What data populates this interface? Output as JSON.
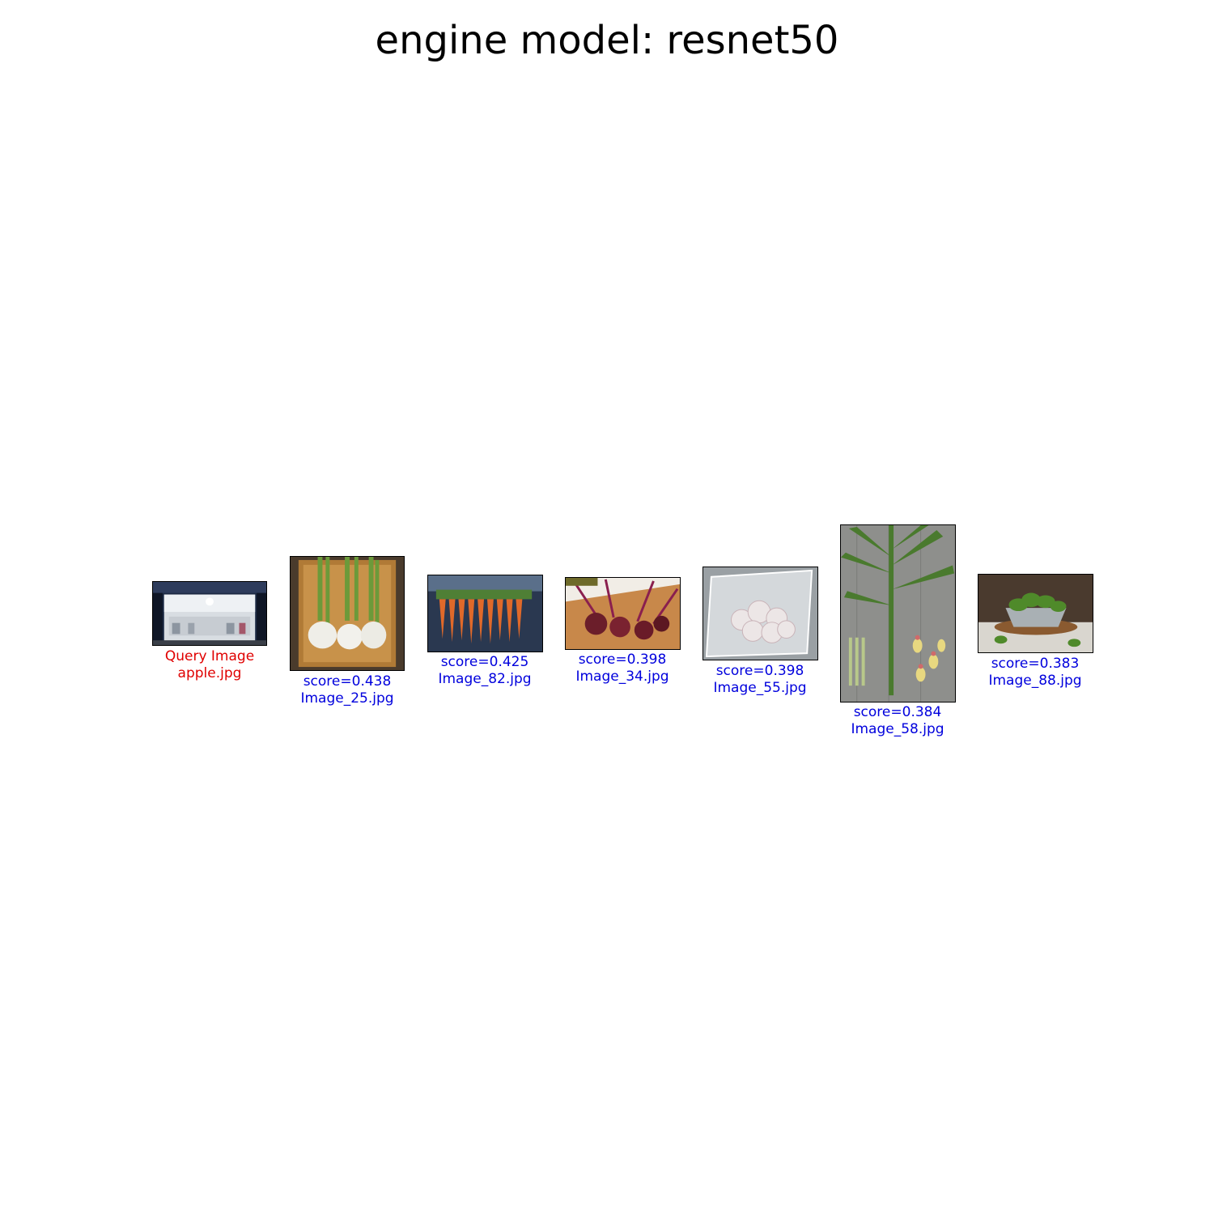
{
  "title": "engine model: resnet50",
  "query": {
    "label": "Query Image",
    "filename": "apple.jpg",
    "caption_color": "#e00000",
    "thumb_icon": "storefront-photo"
  },
  "results": [
    {
      "score_text": "score=0.438",
      "filename": "Image_25.jpg",
      "thumb_icon": "turnip-photo"
    },
    {
      "score_text": "score=0.425",
      "filename": "Image_82.jpg",
      "thumb_icon": "carrot-photo"
    },
    {
      "score_text": "score=0.398",
      "filename": "Image_34.jpg",
      "thumb_icon": "beet-photo"
    },
    {
      "score_text": "score=0.398",
      "filename": "Image_55.jpg",
      "thumb_icon": "garlic-photo"
    },
    {
      "score_text": "score=0.384",
      "filename": "Image_58.jpg",
      "thumb_icon": "ginger-plant-photo"
    },
    {
      "score_text": "score=0.383",
      "filename": "Image_88.jpg",
      "thumb_icon": "spinach-bowl-photo"
    }
  ],
  "result_caption_color": "#0000dd"
}
